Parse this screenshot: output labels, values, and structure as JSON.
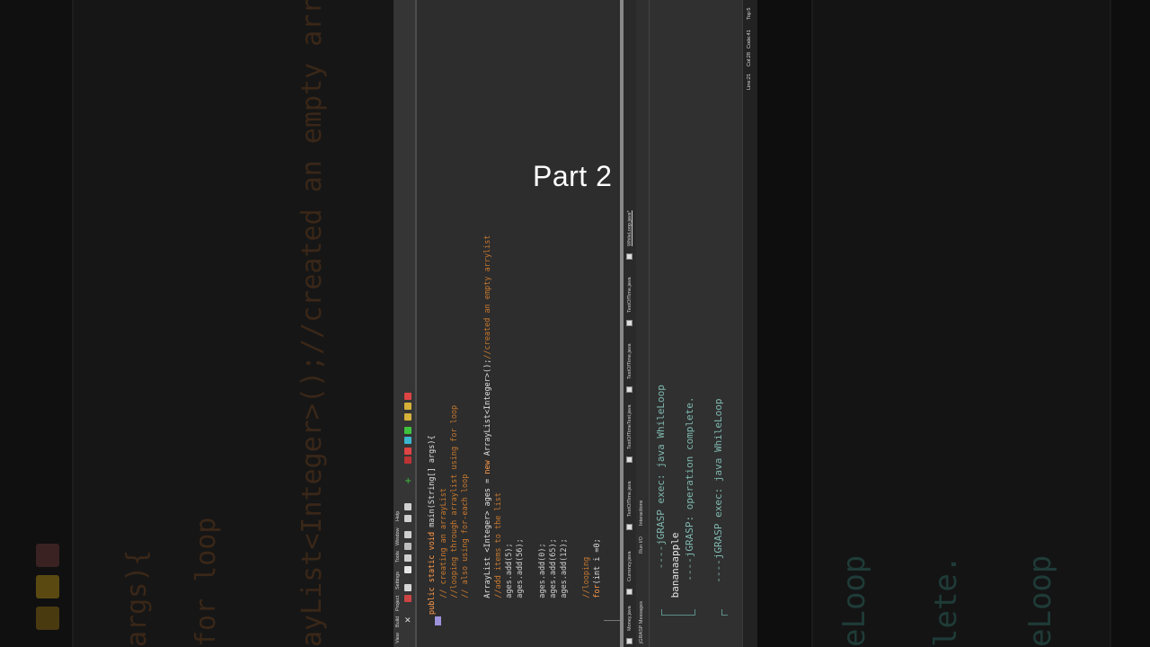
{
  "overlay": {
    "title": "Part 2"
  },
  "menu": [
    "View",
    "Build",
    "Project",
    "Settings",
    "Tools",
    "Window",
    "Help"
  ],
  "editor": {
    "lines": [
      {
        "kind": "code",
        "text": "public static void main(String[] args){"
      },
      {
        "kind": "comment",
        "text": "  // creating an arrayList"
      },
      {
        "kind": "comment",
        "text": "  //looping through arraylist using for loop"
      },
      {
        "kind": "comment",
        "text": "  // also using for-each loop"
      },
      {
        "kind": "blank",
        "text": ""
      },
      {
        "kind": "code",
        "text": "  ArrayList <Integer> ages = new ArrayList<Integer>();//created an empty arrylist"
      },
      {
        "kind": "comment",
        "text": "  //add items to the list"
      },
      {
        "kind": "code",
        "text": "  ages.add(5);"
      },
      {
        "kind": "code",
        "text": "  ages.add(56);"
      },
      {
        "kind": "blank",
        "text": ""
      },
      {
        "kind": "code",
        "text": "  ages.add(0);"
      },
      {
        "kind": "code",
        "text": "  ages.add(65);"
      },
      {
        "kind": "code",
        "text": "  ages.add(12);"
      },
      {
        "kind": "blank",
        "text": ""
      },
      {
        "kind": "comment",
        "text": "  //looping"
      },
      {
        "kind": "code",
        "text": "  for(int i =0;"
      }
    ]
  },
  "file_tabs": [
    "Money.java",
    "Currency.java",
    "TestOfTime.java",
    "TestOfTimeTest.java",
    "TestOfTime.java",
    "TestOfTime.java",
    "WhileLoop.java*"
  ],
  "message_tabs": [
    "jGRASP Messages",
    "Run I/O",
    "Interactions"
  ],
  "console": {
    "lines": [
      {
        "text": " ----jGRASP exec: java WhileLoop",
        "color": "#7fb7ae"
      },
      {
        "text": " bananaapple",
        "color": "#e6e6e6"
      },
      {
        "text": "  ----jGRASP: operation complete.",
        "color": "#7fb7ae"
      },
      {
        "text": "",
        "color": "#e6e6e6"
      },
      {
        "text": "  ----jGRASP exec: java WhileLoop",
        "color": "#7fb7ae"
      }
    ]
  },
  "status": {
    "line": "Line:21",
    "col": "Col:28",
    "code": "Code:41",
    "top": "Top:5"
  },
  "ghost": {
    "left_code_1": "args){",
    "left_code_2": "for loop",
    "left_code_3": "ayList<Integer>();//created an empty arry",
    "right_1": "eLoop",
    "right_2": "lete.",
    "right_3": "eLoop"
  },
  "colors": {
    "keyword": "#ff9a4a",
    "comment": "#c8792f",
    "console_meta": "#7fb7ae",
    "cursor": "#9d92dc"
  }
}
